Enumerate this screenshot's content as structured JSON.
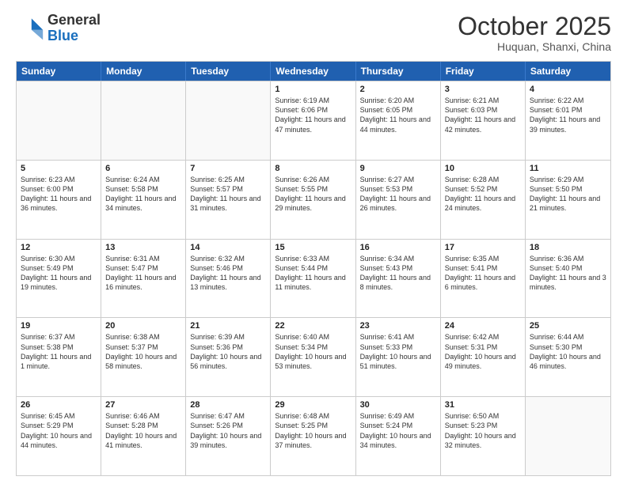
{
  "logo": {
    "general": "General",
    "blue": "Blue"
  },
  "header": {
    "month": "October 2025",
    "location": "Huquan, Shanxi, China"
  },
  "weekdays": [
    "Sunday",
    "Monday",
    "Tuesday",
    "Wednesday",
    "Thursday",
    "Friday",
    "Saturday"
  ],
  "weeks": [
    [
      {
        "day": "",
        "info": ""
      },
      {
        "day": "",
        "info": ""
      },
      {
        "day": "",
        "info": ""
      },
      {
        "day": "1",
        "info": "Sunrise: 6:19 AM\nSunset: 6:06 PM\nDaylight: 11 hours and 47 minutes."
      },
      {
        "day": "2",
        "info": "Sunrise: 6:20 AM\nSunset: 6:05 PM\nDaylight: 11 hours and 44 minutes."
      },
      {
        "day": "3",
        "info": "Sunrise: 6:21 AM\nSunset: 6:03 PM\nDaylight: 11 hours and 42 minutes."
      },
      {
        "day": "4",
        "info": "Sunrise: 6:22 AM\nSunset: 6:01 PM\nDaylight: 11 hours and 39 minutes."
      }
    ],
    [
      {
        "day": "5",
        "info": "Sunrise: 6:23 AM\nSunset: 6:00 PM\nDaylight: 11 hours and 36 minutes."
      },
      {
        "day": "6",
        "info": "Sunrise: 6:24 AM\nSunset: 5:58 PM\nDaylight: 11 hours and 34 minutes."
      },
      {
        "day": "7",
        "info": "Sunrise: 6:25 AM\nSunset: 5:57 PM\nDaylight: 11 hours and 31 minutes."
      },
      {
        "day": "8",
        "info": "Sunrise: 6:26 AM\nSunset: 5:55 PM\nDaylight: 11 hours and 29 minutes."
      },
      {
        "day": "9",
        "info": "Sunrise: 6:27 AM\nSunset: 5:53 PM\nDaylight: 11 hours and 26 minutes."
      },
      {
        "day": "10",
        "info": "Sunrise: 6:28 AM\nSunset: 5:52 PM\nDaylight: 11 hours and 24 minutes."
      },
      {
        "day": "11",
        "info": "Sunrise: 6:29 AM\nSunset: 5:50 PM\nDaylight: 11 hours and 21 minutes."
      }
    ],
    [
      {
        "day": "12",
        "info": "Sunrise: 6:30 AM\nSunset: 5:49 PM\nDaylight: 11 hours and 19 minutes."
      },
      {
        "day": "13",
        "info": "Sunrise: 6:31 AM\nSunset: 5:47 PM\nDaylight: 11 hours and 16 minutes."
      },
      {
        "day": "14",
        "info": "Sunrise: 6:32 AM\nSunset: 5:46 PM\nDaylight: 11 hours and 13 minutes."
      },
      {
        "day": "15",
        "info": "Sunrise: 6:33 AM\nSunset: 5:44 PM\nDaylight: 11 hours and 11 minutes."
      },
      {
        "day": "16",
        "info": "Sunrise: 6:34 AM\nSunset: 5:43 PM\nDaylight: 11 hours and 8 minutes."
      },
      {
        "day": "17",
        "info": "Sunrise: 6:35 AM\nSunset: 5:41 PM\nDaylight: 11 hours and 6 minutes."
      },
      {
        "day": "18",
        "info": "Sunrise: 6:36 AM\nSunset: 5:40 PM\nDaylight: 11 hours and 3 minutes."
      }
    ],
    [
      {
        "day": "19",
        "info": "Sunrise: 6:37 AM\nSunset: 5:38 PM\nDaylight: 11 hours and 1 minute."
      },
      {
        "day": "20",
        "info": "Sunrise: 6:38 AM\nSunset: 5:37 PM\nDaylight: 10 hours and 58 minutes."
      },
      {
        "day": "21",
        "info": "Sunrise: 6:39 AM\nSunset: 5:36 PM\nDaylight: 10 hours and 56 minutes."
      },
      {
        "day": "22",
        "info": "Sunrise: 6:40 AM\nSunset: 5:34 PM\nDaylight: 10 hours and 53 minutes."
      },
      {
        "day": "23",
        "info": "Sunrise: 6:41 AM\nSunset: 5:33 PM\nDaylight: 10 hours and 51 minutes."
      },
      {
        "day": "24",
        "info": "Sunrise: 6:42 AM\nSunset: 5:31 PM\nDaylight: 10 hours and 49 minutes."
      },
      {
        "day": "25",
        "info": "Sunrise: 6:44 AM\nSunset: 5:30 PM\nDaylight: 10 hours and 46 minutes."
      }
    ],
    [
      {
        "day": "26",
        "info": "Sunrise: 6:45 AM\nSunset: 5:29 PM\nDaylight: 10 hours and 44 minutes."
      },
      {
        "day": "27",
        "info": "Sunrise: 6:46 AM\nSunset: 5:28 PM\nDaylight: 10 hours and 41 minutes."
      },
      {
        "day": "28",
        "info": "Sunrise: 6:47 AM\nSunset: 5:26 PM\nDaylight: 10 hours and 39 minutes."
      },
      {
        "day": "29",
        "info": "Sunrise: 6:48 AM\nSunset: 5:25 PM\nDaylight: 10 hours and 37 minutes."
      },
      {
        "day": "30",
        "info": "Sunrise: 6:49 AM\nSunset: 5:24 PM\nDaylight: 10 hours and 34 minutes."
      },
      {
        "day": "31",
        "info": "Sunrise: 6:50 AM\nSunset: 5:23 PM\nDaylight: 10 hours and 32 minutes."
      },
      {
        "day": "",
        "info": ""
      }
    ]
  ]
}
